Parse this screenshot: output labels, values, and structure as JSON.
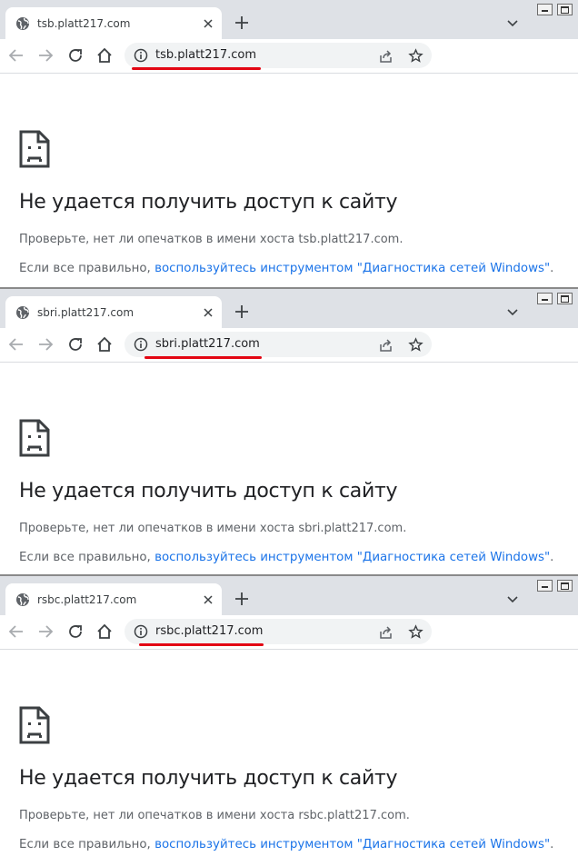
{
  "colors": {
    "tabstrip": "#dee1e6",
    "link": "#1a73e8",
    "annotation_underline": "#e30613",
    "text_primary": "#202124",
    "text_secondary": "#5f6368"
  },
  "windows": [
    {
      "tab": {
        "title": "tsb.platt217.com",
        "icon": "globe-icon"
      },
      "omnibox": {
        "url": "tsb.platt217.com"
      },
      "error": {
        "title": "Не удается получить доступ к сайту",
        "line1": "Проверьте, нет ли опечатков в имени хоста tsb.platt217.com.",
        "line2_prefix": "Если все правильно,",
        "line2_link": "воспользуйтесь инструментом \"Диагностика сетей Windows\"",
        "line2_suffix": "."
      }
    },
    {
      "tab": {
        "title": "sbri.platt217.com",
        "icon": "globe-icon"
      },
      "omnibox": {
        "url": "sbri.platt217.com"
      },
      "error": {
        "title": "Не удается получить доступ к сайту",
        "line1": "Проверьте, нет ли опечатков в имени хоста sbri.platt217.com.",
        "line2_prefix": "Если все правильно,",
        "line2_link": "воспользуйтесь инструментом \"Диагностика сетей Windows\"",
        "line2_suffix": "."
      }
    },
    {
      "tab": {
        "title": "rsbc.platt217.com",
        "icon": "globe-icon"
      },
      "omnibox": {
        "url": "rsbc.platt217.com"
      },
      "error": {
        "title": "Не удается получить доступ к сайту",
        "line1": "Проверьте, нет ли опечатков в имени хоста rsbc.platt217.com.",
        "line2_prefix": "Если все правильно,",
        "line2_link": "воспользуйтесь инструментом \"Диагностика сетей Windows\"",
        "line2_suffix": "."
      }
    }
  ]
}
